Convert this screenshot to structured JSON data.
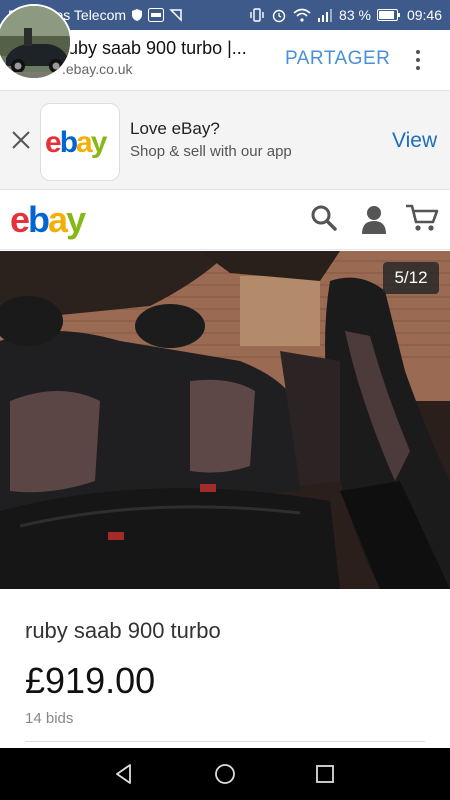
{
  "status_bar": {
    "carrier": "Bouygues Telecom",
    "battery": "83 %",
    "time": "09:46",
    "icons": [
      "shield-icon",
      "ebay-notification-icon",
      "check-icon",
      "vibrate-icon",
      "alarm-icon",
      "wifi-icon",
      "signal-icon",
      "battery-icon"
    ]
  },
  "header": {
    "title": "ruby saab 900 turbo |...",
    "url": ".ebay.co.uk",
    "share_label": "PARTAGER",
    "more_icon": "more-vert-icon"
  },
  "app_banner": {
    "title": "Love eBay?",
    "subtitle": "Shop & sell with our app",
    "view_label": "View",
    "logo_letters": [
      "e",
      "b",
      "a",
      "y"
    ],
    "logo_colors": [
      "#e53238",
      "#0064d2",
      "#f5af02",
      "#86b817"
    ]
  },
  "site_header": {
    "logo_letters": [
      "e",
      "b",
      "a",
      "y"
    ],
    "icons": [
      "search-icon",
      "user-icon",
      "cart-icon"
    ]
  },
  "gallery": {
    "counter": "5/12"
  },
  "product": {
    "title": "ruby saab 900 turbo",
    "price": "£919.00",
    "bids": "14 bids"
  },
  "nav_bar": {
    "icons": [
      "back-icon",
      "home-icon",
      "recent-apps-icon"
    ]
  }
}
